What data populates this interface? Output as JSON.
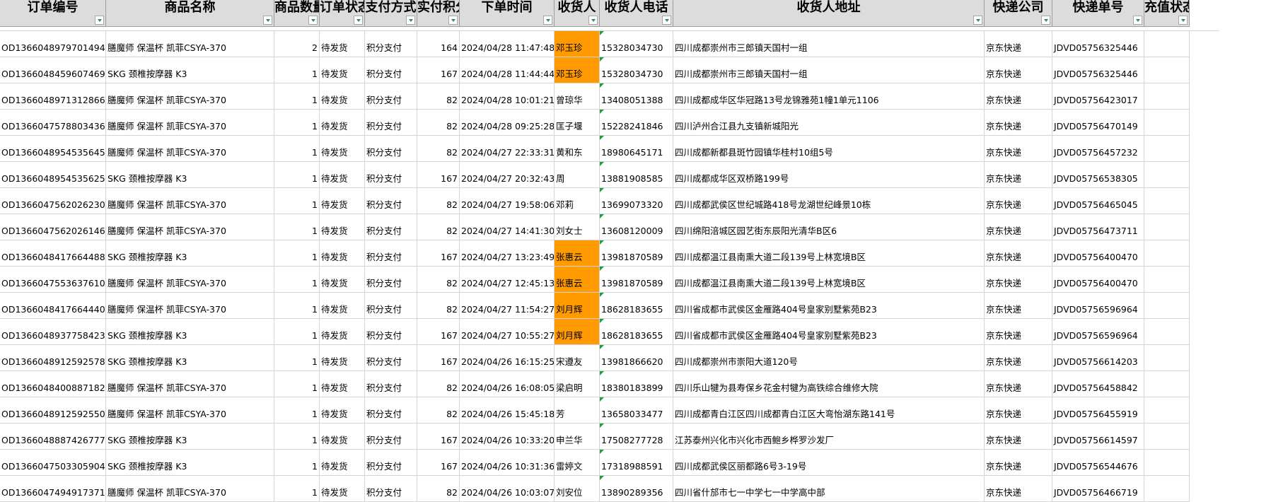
{
  "columns": [
    {
      "label": "订单编号",
      "align": "left"
    },
    {
      "label": "商品名称",
      "align": "left"
    },
    {
      "label": "商品数量",
      "align": "right"
    },
    {
      "label": "订单状态",
      "align": "left"
    },
    {
      "label": "支付方式",
      "align": "left"
    },
    {
      "label": "实付积分",
      "align": "right"
    },
    {
      "label": "下单时间",
      "align": "left"
    },
    {
      "label": "收货人",
      "align": "left"
    },
    {
      "label": "收货人电话",
      "align": "left"
    },
    {
      "label": "收货人地址",
      "align": "left"
    },
    {
      "label": "快递公司",
      "align": "left"
    },
    {
      "label": "快递单号",
      "align": "left"
    },
    {
      "label": "充值状态",
      "align": "left"
    }
  ],
  "highlight_color": "#ff9a00",
  "rows": [
    {
      "cells": [
        "OD1366048979701494",
        "膳魔师 保温杯 凯菲CSYA-370",
        "2",
        "待发货",
        "积分支付",
        "164",
        "2024/04/28 11:47:48",
        "邓玉珍",
        "15328034730",
        "四川成都崇州市三郎镇天国村一组",
        "京东快递",
        "JDVD05756325446",
        ""
      ],
      "highlight": true
    },
    {
      "cells": [
        "OD1366048459607469",
        "SKG 颈椎按摩器 K3",
        "1",
        "待发货",
        "积分支付",
        "167",
        "2024/04/28 11:44:44",
        "邓玉珍",
        "15328034730",
        "四川成都崇州市三郎镇天国村一组",
        "京东快递",
        "JDVD05756325446",
        ""
      ],
      "highlight": true
    },
    {
      "cells": [
        "OD1366048971312866",
        "膳魔师 保温杯 凯菲CSYA-370",
        "1",
        "待发货",
        "积分支付",
        "82",
        "2024/04/28 10:01:21",
        "曾琼华",
        "13408051388",
        "四川成都成华区华冠路13号龙锦雅苑1幢1单元1106",
        "京东快递",
        "JDVD05756423017",
        ""
      ],
      "highlight": false
    },
    {
      "cells": [
        "OD1366047578803436",
        "膳魔师 保温杯 凯菲CSYA-370",
        "1",
        "待发货",
        "积分支付",
        "82",
        "2024/04/28 09:25:28",
        "匡子堰",
        "15228241846",
        "四川泸州合江县九支镇新城阳光",
        "京东快递",
        "JDVD05756470149",
        ""
      ],
      "highlight": false
    },
    {
      "cells": [
        "OD1366048954535645",
        "膳魔师 保温杯 凯菲CSYA-370",
        "1",
        "待发货",
        "积分支付",
        "82",
        "2024/04/27 22:33:31",
        "黄和东",
        "18980645171",
        "四川成都新都县斑竹园镇华桂村10组5号",
        "京东快递",
        "JDVD05756457232",
        ""
      ],
      "highlight": false
    },
    {
      "cells": [
        "OD1366048954535625",
        "SKG 颈椎按摩器 K3",
        "1",
        "待发货",
        "积分支付",
        "167",
        "2024/04/27 20:32:43",
        "周",
        "13881908585",
        "四川成都成华区双桥路199号",
        "京东快递",
        "JDVD05756538305",
        ""
      ],
      "highlight": false
    },
    {
      "cells": [
        "OD1366047562026230",
        "膳魔师 保温杯 凯菲CSYA-370",
        "1",
        "待发货",
        "积分支付",
        "82",
        "2024/04/27 19:58:06",
        "邓莉",
        "13699073320",
        "四川成都武侯区世纪城路418号龙湖世纪峰景10栋",
        "京东快递",
        "JDVD05756465045",
        ""
      ],
      "highlight": false
    },
    {
      "cells": [
        "OD1366047562026146",
        "膳魔师 保温杯 凯菲CSYA-370",
        "1",
        "待发货",
        "积分支付",
        "82",
        "2024/04/27 14:41:30",
        "刘女士",
        "13608120009",
        "四川绵阳涪城区园艺街东辰阳光清华B区6",
        "京东快递",
        "JDVD05756473711",
        ""
      ],
      "highlight": false
    },
    {
      "cells": [
        "OD1366048417664488",
        "SKG 颈椎按摩器 K3",
        "1",
        "待发货",
        "积分支付",
        "167",
        "2024/04/27 13:23:49",
        "张惠云",
        "13981870589",
        "四川成都温江县南熏大道二段139号上林宽境B区",
        "京东快递",
        "JDVD05756400470",
        ""
      ],
      "highlight": true
    },
    {
      "cells": [
        "OD1366047553637610",
        "膳魔师 保温杯 凯菲CSYA-370",
        "1",
        "待发货",
        "积分支付",
        "82",
        "2024/04/27 12:45:13",
        "张惠云",
        "13981870589",
        "四川成都温江县南熏大道二段139号上林宽境B区",
        "京东快递",
        "JDVD05756400470",
        ""
      ],
      "highlight": true
    },
    {
      "cells": [
        "OD1366048417664440",
        "膳魔师 保温杯 凯菲CSYA-370",
        "1",
        "待发货",
        "积分支付",
        "82",
        "2024/04/27 11:54:27",
        "刘月辉",
        "18628183655",
        "四川省成都市武侯区金雁路404号皇家别墅紫苑B23",
        "京东快递",
        "JDVD05756596964",
        ""
      ],
      "highlight": true
    },
    {
      "cells": [
        "OD1366048937758423",
        "SKG 颈椎按摩器 K3",
        "1",
        "待发货",
        "积分支付",
        "167",
        "2024/04/27 10:55:27",
        "刘月辉",
        "18628183655",
        "四川省成都市武侯区金雁路404号皇家别墅紫苑B23",
        "京东快递",
        "JDVD05756596964",
        ""
      ],
      "highlight": true
    },
    {
      "cells": [
        "OD1366048912592578",
        "SKG 颈椎按摩器 K3",
        "1",
        "待发货",
        "积分支付",
        "167",
        "2024/04/26 16:15:25",
        "宋遵友",
        "13981866620",
        "四川成都崇州市崇阳大道120号",
        "京东快递",
        "JDVD05756614203",
        ""
      ],
      "highlight": false
    },
    {
      "cells": [
        "OD1366048400887182",
        "膳魔师 保温杯 凯菲CSYA-370",
        "1",
        "待发货",
        "积分支付",
        "82",
        "2024/04/26 16:08:05",
        "梁启明",
        "18380183899",
        "四川乐山犍为县寿保乡花金村犍为高铁综合维修大院",
        "京东快递",
        "JDVD05756458842",
        ""
      ],
      "highlight": false
    },
    {
      "cells": [
        "OD1366048912592550",
        "膳魔师 保温杯 凯菲CSYA-370",
        "1",
        "待发货",
        "积分支付",
        "82",
        "2024/04/26 15:45:18",
        "芳",
        "13658033477",
        "四川成都青白江区四川成都青白江区大弯怡湖东路141号",
        "京东快递",
        "JDVD05756455919",
        ""
      ],
      "highlight": false
    },
    {
      "cells": [
        "OD1366048887426777",
        "SKG 颈椎按摩器 K3",
        "1",
        "待发货",
        "积分支付",
        "167",
        "2024/04/26 10:33:20",
        "申兰华",
        "17508277728",
        "江苏泰州兴化市兴化市西鲍乡桦罗沙发厂",
        "京东快递",
        "JDVD05756614597",
        ""
      ],
      "highlight": false
    },
    {
      "cells": [
        "OD1366047503305904",
        "SKG 颈椎按摩器 K3",
        "1",
        "待发货",
        "积分支付",
        "167",
        "2024/04/26 10:31:36",
        "雷婷文",
        "17318988591",
        "四川成都武侯区丽都路6号3-19号",
        "京东快递",
        "JDVD05756544676",
        ""
      ],
      "highlight": false
    },
    {
      "cells": [
        "OD1366047494917371",
        "膳魔师 保温杯 凯菲CSYA-370",
        "1",
        "待发货",
        "积分支付",
        "82",
        "2024/04/26 10:03:07",
        "刘安位",
        "13890289356",
        "四川省什邡市七一中学七一中学高中部",
        "京东快递",
        "JDVD05756466719",
        ""
      ],
      "highlight": false
    }
  ]
}
